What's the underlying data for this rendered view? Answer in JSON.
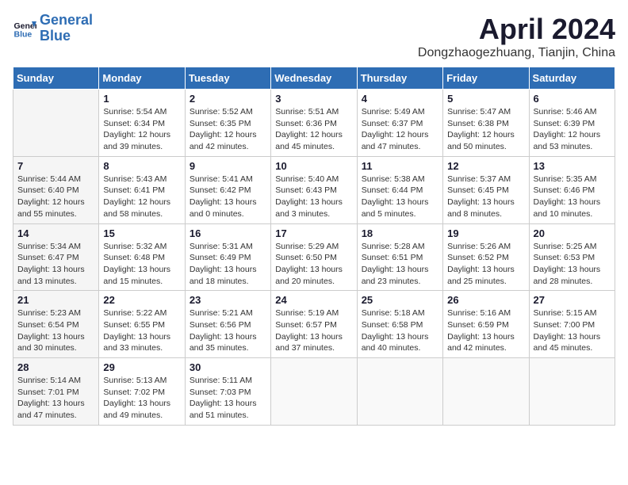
{
  "header": {
    "logo_line1": "General",
    "logo_line2": "Blue",
    "title": "April 2024",
    "location": "Dongzhaogezhuang, Tianjin, China"
  },
  "days_of_week": [
    "Sunday",
    "Monday",
    "Tuesday",
    "Wednesday",
    "Thursday",
    "Friday",
    "Saturday"
  ],
  "weeks": [
    [
      {
        "day": "",
        "sunrise": "",
        "sunset": "",
        "daylight": ""
      },
      {
        "day": "1",
        "sunrise": "Sunrise: 5:54 AM",
        "sunset": "Sunset: 6:34 PM",
        "daylight": "Daylight: 12 hours and 39 minutes."
      },
      {
        "day": "2",
        "sunrise": "Sunrise: 5:52 AM",
        "sunset": "Sunset: 6:35 PM",
        "daylight": "Daylight: 12 hours and 42 minutes."
      },
      {
        "day": "3",
        "sunrise": "Sunrise: 5:51 AM",
        "sunset": "Sunset: 6:36 PM",
        "daylight": "Daylight: 12 hours and 45 minutes."
      },
      {
        "day": "4",
        "sunrise": "Sunrise: 5:49 AM",
        "sunset": "Sunset: 6:37 PM",
        "daylight": "Daylight: 12 hours and 47 minutes."
      },
      {
        "day": "5",
        "sunrise": "Sunrise: 5:47 AM",
        "sunset": "Sunset: 6:38 PM",
        "daylight": "Daylight: 12 hours and 50 minutes."
      },
      {
        "day": "6",
        "sunrise": "Sunrise: 5:46 AM",
        "sunset": "Sunset: 6:39 PM",
        "daylight": "Daylight: 12 hours and 53 minutes."
      }
    ],
    [
      {
        "day": "7",
        "sunrise": "Sunrise: 5:44 AM",
        "sunset": "Sunset: 6:40 PM",
        "daylight": "Daylight: 12 hours and 55 minutes."
      },
      {
        "day": "8",
        "sunrise": "Sunrise: 5:43 AM",
        "sunset": "Sunset: 6:41 PM",
        "daylight": "Daylight: 12 hours and 58 minutes."
      },
      {
        "day": "9",
        "sunrise": "Sunrise: 5:41 AM",
        "sunset": "Sunset: 6:42 PM",
        "daylight": "Daylight: 13 hours and 0 minutes."
      },
      {
        "day": "10",
        "sunrise": "Sunrise: 5:40 AM",
        "sunset": "Sunset: 6:43 PM",
        "daylight": "Daylight: 13 hours and 3 minutes."
      },
      {
        "day": "11",
        "sunrise": "Sunrise: 5:38 AM",
        "sunset": "Sunset: 6:44 PM",
        "daylight": "Daylight: 13 hours and 5 minutes."
      },
      {
        "day": "12",
        "sunrise": "Sunrise: 5:37 AM",
        "sunset": "Sunset: 6:45 PM",
        "daylight": "Daylight: 13 hours and 8 minutes."
      },
      {
        "day": "13",
        "sunrise": "Sunrise: 5:35 AM",
        "sunset": "Sunset: 6:46 PM",
        "daylight": "Daylight: 13 hours and 10 minutes."
      }
    ],
    [
      {
        "day": "14",
        "sunrise": "Sunrise: 5:34 AM",
        "sunset": "Sunset: 6:47 PM",
        "daylight": "Daylight: 13 hours and 13 minutes."
      },
      {
        "day": "15",
        "sunrise": "Sunrise: 5:32 AM",
        "sunset": "Sunset: 6:48 PM",
        "daylight": "Daylight: 13 hours and 15 minutes."
      },
      {
        "day": "16",
        "sunrise": "Sunrise: 5:31 AM",
        "sunset": "Sunset: 6:49 PM",
        "daylight": "Daylight: 13 hours and 18 minutes."
      },
      {
        "day": "17",
        "sunrise": "Sunrise: 5:29 AM",
        "sunset": "Sunset: 6:50 PM",
        "daylight": "Daylight: 13 hours and 20 minutes."
      },
      {
        "day": "18",
        "sunrise": "Sunrise: 5:28 AM",
        "sunset": "Sunset: 6:51 PM",
        "daylight": "Daylight: 13 hours and 23 minutes."
      },
      {
        "day": "19",
        "sunrise": "Sunrise: 5:26 AM",
        "sunset": "Sunset: 6:52 PM",
        "daylight": "Daylight: 13 hours and 25 minutes."
      },
      {
        "day": "20",
        "sunrise": "Sunrise: 5:25 AM",
        "sunset": "Sunset: 6:53 PM",
        "daylight": "Daylight: 13 hours and 28 minutes."
      }
    ],
    [
      {
        "day": "21",
        "sunrise": "Sunrise: 5:23 AM",
        "sunset": "Sunset: 6:54 PM",
        "daylight": "Daylight: 13 hours and 30 minutes."
      },
      {
        "day": "22",
        "sunrise": "Sunrise: 5:22 AM",
        "sunset": "Sunset: 6:55 PM",
        "daylight": "Daylight: 13 hours and 33 minutes."
      },
      {
        "day": "23",
        "sunrise": "Sunrise: 5:21 AM",
        "sunset": "Sunset: 6:56 PM",
        "daylight": "Daylight: 13 hours and 35 minutes."
      },
      {
        "day": "24",
        "sunrise": "Sunrise: 5:19 AM",
        "sunset": "Sunset: 6:57 PM",
        "daylight": "Daylight: 13 hours and 37 minutes."
      },
      {
        "day": "25",
        "sunrise": "Sunrise: 5:18 AM",
        "sunset": "Sunset: 6:58 PM",
        "daylight": "Daylight: 13 hours and 40 minutes."
      },
      {
        "day": "26",
        "sunrise": "Sunrise: 5:16 AM",
        "sunset": "Sunset: 6:59 PM",
        "daylight": "Daylight: 13 hours and 42 minutes."
      },
      {
        "day": "27",
        "sunrise": "Sunrise: 5:15 AM",
        "sunset": "Sunset: 7:00 PM",
        "daylight": "Daylight: 13 hours and 45 minutes."
      }
    ],
    [
      {
        "day": "28",
        "sunrise": "Sunrise: 5:14 AM",
        "sunset": "Sunset: 7:01 PM",
        "daylight": "Daylight: 13 hours and 47 minutes."
      },
      {
        "day": "29",
        "sunrise": "Sunrise: 5:13 AM",
        "sunset": "Sunset: 7:02 PM",
        "daylight": "Daylight: 13 hours and 49 minutes."
      },
      {
        "day": "30",
        "sunrise": "Sunrise: 5:11 AM",
        "sunset": "Sunset: 7:03 PM",
        "daylight": "Daylight: 13 hours and 51 minutes."
      },
      {
        "day": "",
        "sunrise": "",
        "sunset": "",
        "daylight": ""
      },
      {
        "day": "",
        "sunrise": "",
        "sunset": "",
        "daylight": ""
      },
      {
        "day": "",
        "sunrise": "",
        "sunset": "",
        "daylight": ""
      },
      {
        "day": "",
        "sunrise": "",
        "sunset": "",
        "daylight": ""
      }
    ]
  ]
}
